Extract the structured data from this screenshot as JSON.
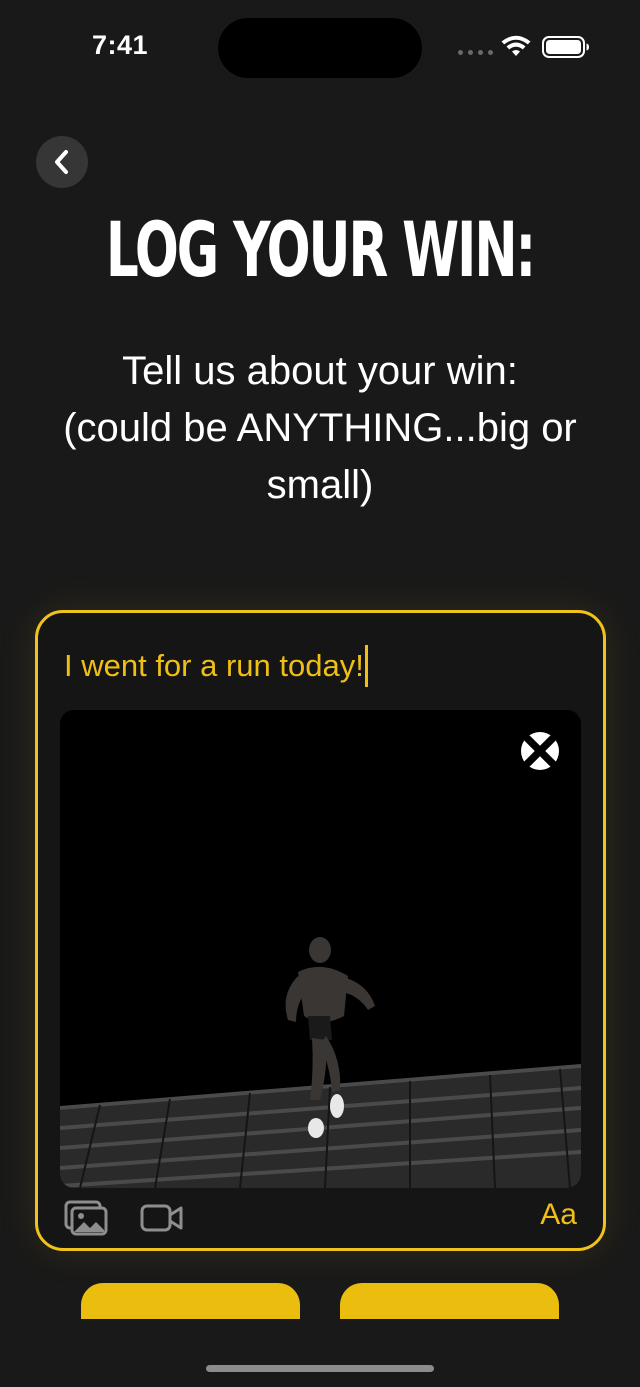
{
  "status_bar": {
    "time": "7:41"
  },
  "header": {
    "title": "LOG YOUR WIN:",
    "subtitle": "Tell us about your win:\n(could be ANYTHING...big or small)"
  },
  "win_card": {
    "text_value": "I went for a run today!",
    "accent_color": "#f0c21b",
    "text_style_label": "Aa"
  },
  "icons": [
    "back-icon",
    "close-icon",
    "photo-library-icon",
    "video-icon",
    "wifi-icon",
    "battery-icon"
  ]
}
